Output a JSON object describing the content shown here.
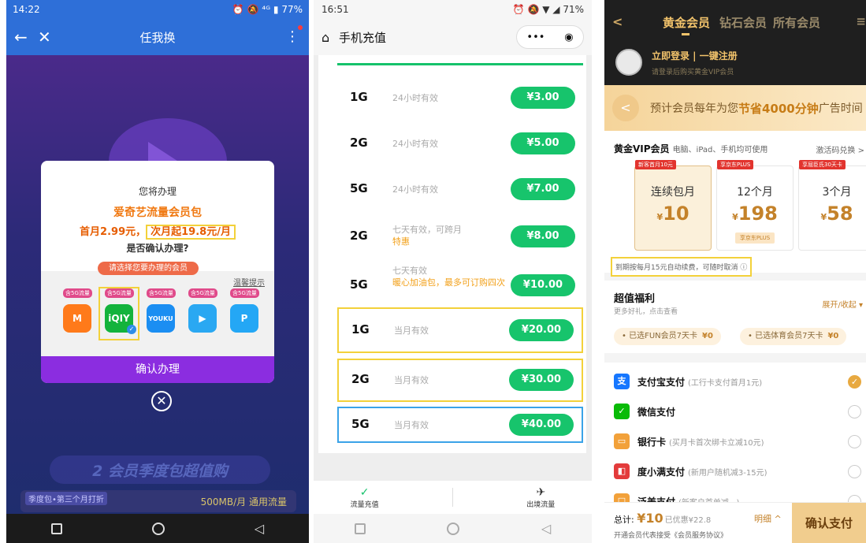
{
  "panel1": {
    "status": {
      "time": "14:22",
      "icons": "⏰ 🔕 ⁴ᴳ ▮",
      "battery": "77%"
    },
    "nav": {
      "title": "任我换",
      "back_icon": "←",
      "close_icon": "✕",
      "more_icon": "⋮"
    },
    "background": {
      "section2_title": "2 会员季度包超值购",
      "bottom_label": "季度包•第三个月打折",
      "bottom_right": "500MB/月 通用流量"
    },
    "modal": {
      "line1": "您将办理",
      "product": "爱奇艺流量会员包",
      "price_first": "首月2.99元，",
      "price_next": "次月起19.8元/月",
      "confirm_question": "是否确认办理?",
      "choose_label": "请选择您要办理的会员",
      "tip_link": "温馨提示",
      "tag_5g": "含5G流量",
      "apps": [
        {
          "name": "mango-tv",
          "text": "M",
          "color": "#ff7a1a"
        },
        {
          "name": "iqiyi",
          "text": "iQIY",
          "color": "#13b33c"
        },
        {
          "name": "youku",
          "text": "YOUKU",
          "color": "#1b8ef2"
        },
        {
          "name": "tencent-video",
          "text": "▶",
          "color": "#2aa8f2"
        },
        {
          "name": "pptv",
          "text": "P",
          "color": "#24a7f5"
        }
      ],
      "confirm_button": "确认办理",
      "close_icon": "✕"
    }
  },
  "panel2": {
    "status": {
      "time": "16:51",
      "icons": "⏰ 🔕 ▼ ◢",
      "battery": "71%"
    },
    "nav": {
      "home_icon": "⌂",
      "title": "手机充值",
      "more_icon": "•••",
      "target_icon": "◉"
    },
    "packages": [
      {
        "size": "1G",
        "desc": "24小时有效",
        "extra": "",
        "price": "¥3.00"
      },
      {
        "size": "2G",
        "desc": "24小时有效",
        "extra": "",
        "price": "¥5.00"
      },
      {
        "size": "5G",
        "desc": "24小时有效",
        "extra": "",
        "price": "¥7.00"
      },
      {
        "size": "2G",
        "desc": "七天有效，可跨月",
        "extra": "特惠",
        "price": "¥8.00"
      },
      {
        "size": "5G",
        "desc": "七天有效",
        "extra": "暖心加油包，最多可订购四次",
        "price": "¥10.00"
      },
      {
        "size": "1G",
        "desc": "当月有效",
        "extra": "",
        "price": "¥20.00"
      },
      {
        "size": "2G",
        "desc": "当月有效",
        "extra": "",
        "price": "¥30.00"
      },
      {
        "size": "5G",
        "desc": "当月有效",
        "extra": "",
        "price": "¥40.00"
      }
    ],
    "bottom_tabs": [
      {
        "label": "流量充值",
        "icon": "✓"
      },
      {
        "label": "出境流量",
        "icon": "✈"
      }
    ]
  },
  "panel3": {
    "tabs": {
      "back_icon": "<",
      "gold": "黄金会员",
      "diamond": "钻石会员",
      "all": "所有会员",
      "menu_icon": "≡"
    },
    "login": {
      "title": "立即登录 | 一键注册",
      "subtitle": "请登录后购买黄金VIP会员"
    },
    "banner": {
      "pre": "预计会员每年为您",
      "highlight": "节省4000分钟",
      "post": "广告时间"
    },
    "vip": {
      "title": "黄金VIP会员",
      "devices": "电脑、iPad、手机均可使用",
      "redeem": "激活码兑换 >"
    },
    "plans": [
      {
        "tag": "新客首月10元",
        "name": "连续包月",
        "price": "10"
      },
      {
        "tag": "享京东PLUS",
        "name": "12个月",
        "price": "198",
        "plus": "享京东PLUS"
      },
      {
        "tag": "享屈臣氏30天卡",
        "name": "3个月",
        "price": "58"
      }
    ],
    "renew_note": "到期按每月15元自动续费，可随时取消 ⓘ",
    "benefit": {
      "title": "超值福利",
      "subtitle": "更多好礼，点击查看",
      "toggle": "展开/收起 ▾",
      "chips": [
        {
          "label": "• 已选FUN会员7天卡",
          "price": "¥0"
        },
        {
          "label": "• 已选体育会员7天卡",
          "price": "¥0"
        }
      ]
    },
    "payments": [
      {
        "name": "支付宝支付",
        "note": "(工行卡支付首月1元)",
        "icon": "支",
        "color": "#1677ff",
        "selected": true
      },
      {
        "name": "微信支付",
        "note": "",
        "icon": "✓",
        "color": "#09bb07",
        "selected": false
      },
      {
        "name": "银行卡",
        "note": "(买月卡首次绑卡立减10元)",
        "icon": "▭",
        "color": "#f2a13a",
        "selected": false
      },
      {
        "name": "度小满支付",
        "note": "(新用户随机减3-15元)",
        "icon": "◧",
        "color": "#e33b3b",
        "selected": false
      },
      {
        "name": "泛美支付",
        "note": "(新客户首单减...)",
        "icon": "□",
        "color": "#f2a13a",
        "selected": false
      }
    ],
    "footer": {
      "total_label": "总计: ",
      "total_value": "¥10",
      "discount": "已优惠¥22.8",
      "detail": "明细 ^",
      "agreement": "开通会员代表接受《会员服务协议》",
      "pay_button": "确认支付"
    }
  }
}
